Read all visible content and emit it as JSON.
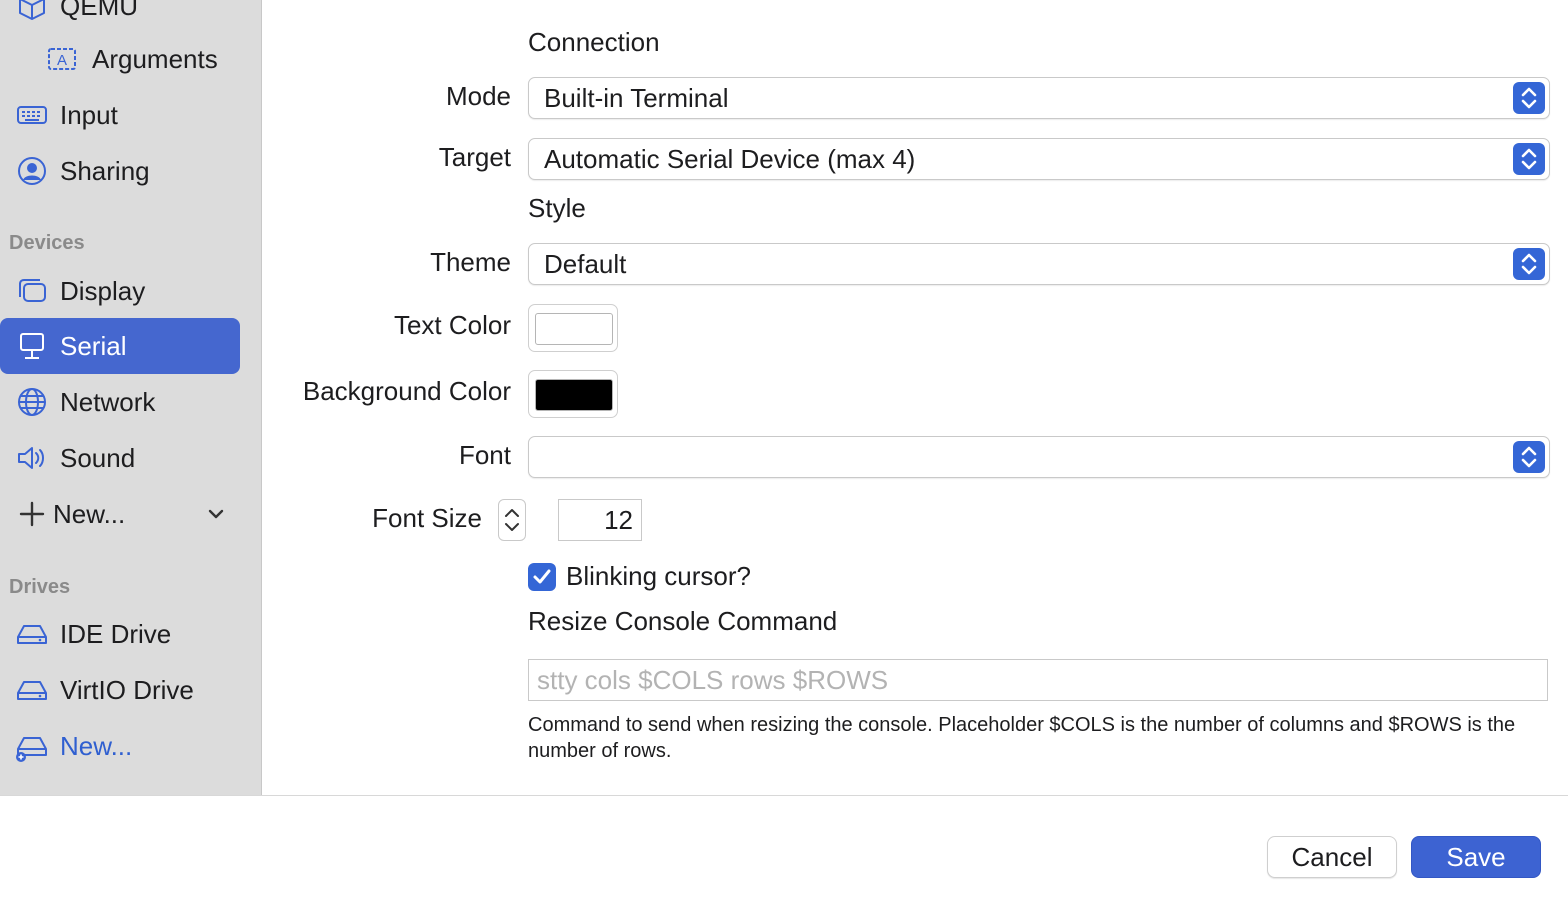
{
  "sidebar": {
    "top_items": [
      {
        "label": "QEMU",
        "icon": "cube-icon"
      },
      {
        "label": "Arguments",
        "icon": "text-box-icon"
      },
      {
        "label": "Input",
        "icon": "keyboard-icon"
      },
      {
        "label": "Sharing",
        "icon": "person-circle-icon"
      }
    ],
    "devices_header": "Devices",
    "devices": [
      {
        "label": "Display",
        "icon": "display-icon"
      },
      {
        "label": "Serial",
        "icon": "serial-icon",
        "selected": true
      },
      {
        "label": "Network",
        "icon": "globe-icon"
      },
      {
        "label": "Sound",
        "icon": "speaker-icon"
      }
    ],
    "new_device_label": "New...",
    "drives_header": "Drives",
    "drives": [
      {
        "label": "IDE Drive",
        "icon": "drive-icon"
      },
      {
        "label": "VirtIO Drive",
        "icon": "drive-icon"
      }
    ],
    "new_drive_label": "New..."
  },
  "main": {
    "connection_header": "Connection",
    "mode": {
      "label": "Mode",
      "value": "Built-in Terminal"
    },
    "target": {
      "label": "Target",
      "value": "Automatic Serial Device (max 4)"
    },
    "style_header": "Style",
    "theme": {
      "label": "Theme",
      "value": "Default"
    },
    "text_color": {
      "label": "Text Color",
      "value": "#ffffff"
    },
    "background_color": {
      "label": "Background Color",
      "value": "#000000"
    },
    "font": {
      "label": "Font",
      "value": ""
    },
    "font_size": {
      "label": "Font Size",
      "value": "12"
    },
    "blinking_cursor": {
      "label": "Blinking cursor?",
      "checked": true
    },
    "resize_header": "Resize Console Command",
    "resize_command": {
      "value": "",
      "placeholder": "stty cols $COLS rows $ROWS"
    },
    "resize_help": "Command to send when resizing the console. Placeholder $COLS is the number of columns and $ROWS is the number of rows."
  },
  "footer": {
    "cancel_label": "Cancel",
    "save_label": "Save"
  },
  "colors": {
    "accent": "#3466d6",
    "sidebar_bg": "#dcdcdc",
    "selected_bg": "#4567cf"
  }
}
